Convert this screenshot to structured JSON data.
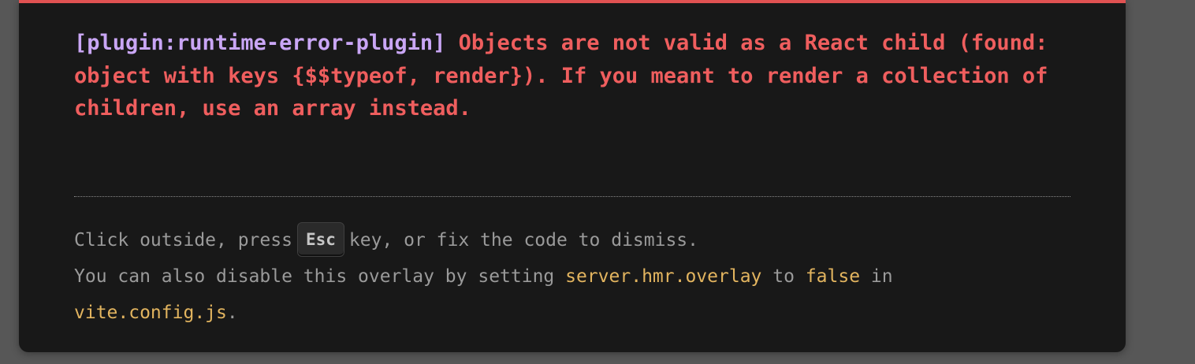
{
  "overlay": {
    "plugin_tag": "[plugin:runtime-error-plugin]",
    "error_message": "Objects are not valid as a React child (found: object with keys {$$typeof, render}). If you meant to render a collection of children, use an array instead."
  },
  "tip": {
    "line1_before": "Click outside, press",
    "key_label": "Esc",
    "line1_after": "key, or fix the code to dismiss.",
    "line2_before": "You can also disable this overlay by setting",
    "setting_name": "server.hmr.overlay",
    "line2_middle": "to",
    "setting_value": "false",
    "line2_after": "in",
    "config_file": "vite.config.js",
    "line3_after": "."
  },
  "colors": {
    "error_red": "#ef5e5e",
    "plugin_purple": "#c9a6f5",
    "code_yellow": "#e2b45f",
    "background": "#181818",
    "top_border": "#e05252"
  }
}
